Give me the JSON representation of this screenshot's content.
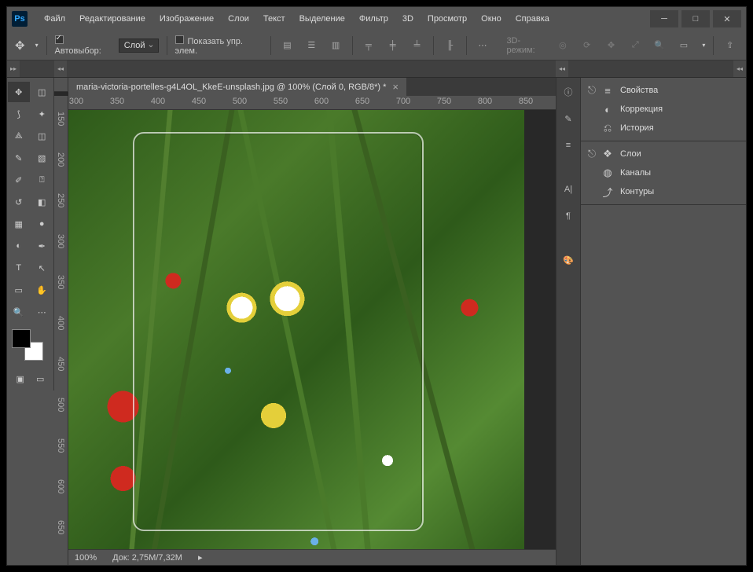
{
  "app": {
    "logo_text": "Ps"
  },
  "menu": [
    "Файл",
    "Редактирование",
    "Изображение",
    "Слои",
    "Текст",
    "Выделение",
    "Фильтр",
    "3D",
    "Просмотр",
    "Окно",
    "Справка"
  ],
  "options": {
    "auto_select_label": "Автовыбор:",
    "auto_select_value": "Слой",
    "show_controls_label": "Показать упр. элем.",
    "mode3d_label": "3D-режим:"
  },
  "document": {
    "tab_title": "maria-victoria-portelles-g4L4OL_KkeE-unsplash.jpg @ 100% (Слой 0, RGB/8*) *"
  },
  "ruler_h": [
    "300",
    "350",
    "400",
    "450",
    "500",
    "550",
    "600",
    "650",
    "700",
    "750",
    "800",
    "850"
  ],
  "ruler_v": [
    "150",
    "200",
    "250",
    "300",
    "350",
    "400",
    "450",
    "500",
    "550",
    "600",
    "650"
  ],
  "status": {
    "zoom": "100%",
    "doc_label": "Док:",
    "doc_value": "2,75M/7,32M"
  },
  "tools": [
    [
      "move",
      "marquee"
    ],
    [
      "lasso",
      "wand"
    ],
    [
      "crop",
      "slice"
    ],
    [
      "eyedrop",
      "patch"
    ],
    [
      "brush",
      "stamp"
    ],
    [
      "history",
      "eraser"
    ],
    [
      "gradient",
      "blur"
    ],
    [
      "dodge",
      "pen"
    ],
    [
      "type",
      "path"
    ],
    [
      "rect",
      "hand"
    ],
    [
      "zoom",
      "more"
    ]
  ],
  "dock": [
    "info-icon",
    "adjust-icon",
    "brush-icon",
    "type-icon",
    "paragraph-icon",
    "color-icon"
  ],
  "panels": {
    "group1": [
      {
        "icon": "sliders",
        "label": "Свойства"
      },
      {
        "icon": "circle",
        "label": "Коррекция"
      },
      {
        "icon": "history",
        "label": "История"
      }
    ],
    "group2": [
      {
        "icon": "layers",
        "label": "Слои"
      },
      {
        "icon": "channels",
        "label": "Каналы"
      },
      {
        "icon": "paths",
        "label": "Контуры"
      }
    ]
  }
}
